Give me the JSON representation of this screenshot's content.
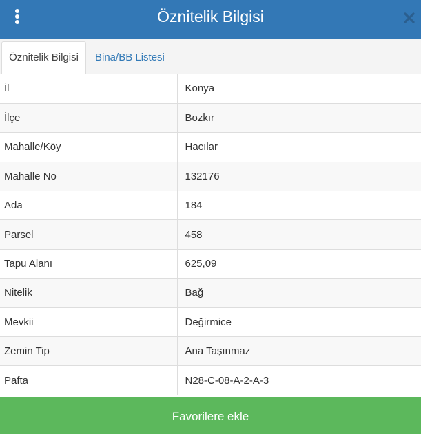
{
  "header": {
    "title": "Öznitelik Bilgisi"
  },
  "tabs": [
    {
      "label": "Öznitelik Bilgisi",
      "active": true
    },
    {
      "label": "Bina/BB Listesi",
      "active": false
    }
  ],
  "attributes": [
    {
      "key": "İl",
      "value": "Konya"
    },
    {
      "key": "İlçe",
      "value": "Bozkır"
    },
    {
      "key": "Mahalle/Köy",
      "value": "Hacılar"
    },
    {
      "key": "Mahalle No",
      "value": "132176"
    },
    {
      "key": "Ada",
      "value": "184"
    },
    {
      "key": "Parsel",
      "value": "458"
    },
    {
      "key": "Tapu Alanı",
      "value": "625,09"
    },
    {
      "key": "Nitelik",
      "value": "Bağ"
    },
    {
      "key": "Mevkii",
      "value": "Değirmice"
    },
    {
      "key": "Zemin Tip",
      "value": "Ana Taşınmaz"
    },
    {
      "key": "Pafta",
      "value": "N28-C-08-A-2-A-3"
    }
  ],
  "footer": {
    "favorite_label": "Favorilere ekle"
  },
  "colors": {
    "header_bg": "#3378b6",
    "tab_link": "#337ab7",
    "button_bg": "#5cb85c",
    "close_icon": "#2b5f8f"
  },
  "icons": {
    "menu": "vertical-ellipsis-icon",
    "close": "close-icon"
  }
}
